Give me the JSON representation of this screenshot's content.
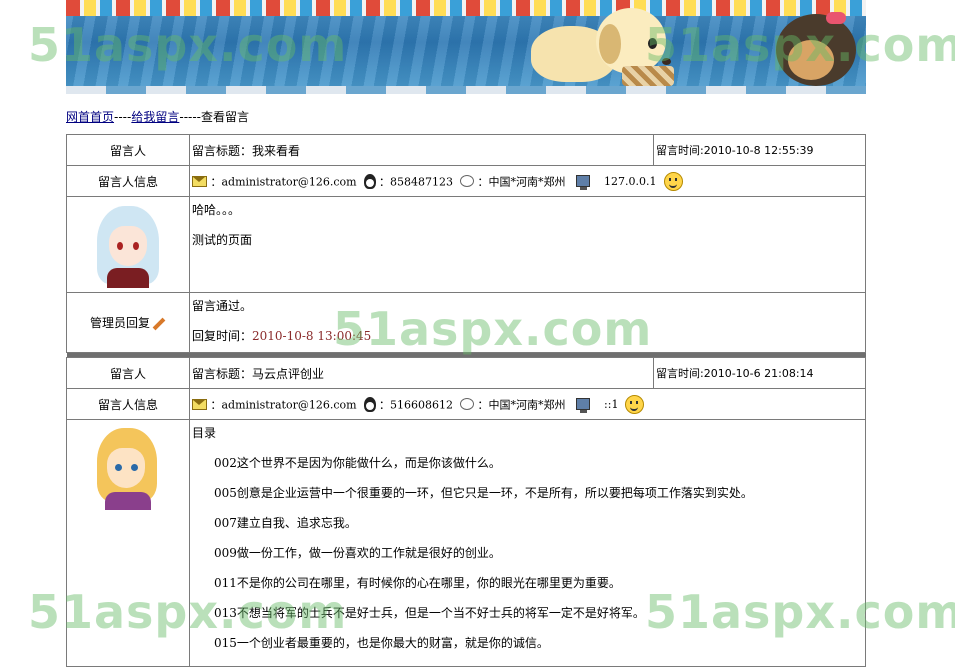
{
  "banner": {
    "alt": "swimming-pool puppies banner"
  },
  "breadcrumb": {
    "home": "网首首页",
    "sep1": "----",
    "leave": "给我留言",
    "sep2": "-----",
    "current": "查看留言"
  },
  "labels": {
    "author": "留言人",
    "author_info": "留言人信息",
    "admin_reply": "管理员回复",
    "title_prefix": "留言标题：",
    "time_prefix": "留言时间:",
    "reply_time_prefix": "回复时间："
  },
  "messages": [
    {
      "title": "我来看看",
      "time": "2010-10-8 12:55:39",
      "email": "：administrator@126.com",
      "qq": "：858487123",
      "location": "：中国*河南*郑州",
      "ip": "127.0.0.1",
      "content": [
        "哈哈。。。",
        "测试的页面"
      ],
      "reply": "留言通过。",
      "reply_time": "2010-10-8 13:00:45"
    },
    {
      "title": "马云点评创业",
      "time": "2010-10-6 21:08:14",
      "email": "：administrator@126.com",
      "qq": "：516608612",
      "location": "：中国*河南*郑州",
      "ip": "::1",
      "content_head": "目录",
      "content": [
        "002这个世界不是因为你能做什么，而是你该做什么。",
        "005创意是企业运营中一个很重要的一环，但它只是一环，不是所有，所以要把每项工作落实到实处。",
        "007建立自我、追求忘我。",
        "009做一份工作，做一份喜欢的工作就是很好的创业。",
        "011不是你的公司在哪里，有时候你的心在哪里，你的眼光在哪里更为重要。",
        "013不想当将军的士兵不是好士兵，但是一个当不好士兵的将军一定不是好将军。",
        "015一个创业者最重要的，也是你最大的财富，就是你的诚信。"
      ]
    }
  ],
  "watermark": "51aspx.com"
}
